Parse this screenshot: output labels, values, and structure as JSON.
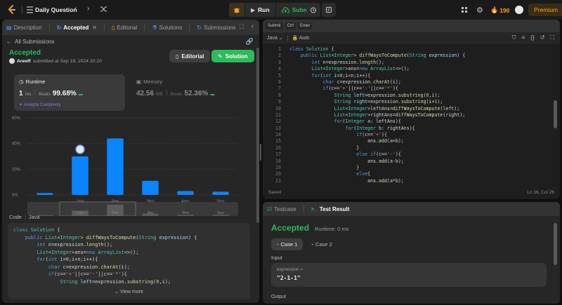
{
  "top": {
    "title": "Daily Question",
    "run_label": "Run",
    "submit_label": "Submit",
    "streak": "190",
    "premium_label": "Premium"
  },
  "left_tabs": [
    {
      "label": "Description"
    },
    {
      "label": "Accepted"
    },
    {
      "label": "Editorial"
    },
    {
      "label": "Solutions"
    },
    {
      "label": "Submissions"
    }
  ],
  "result": {
    "back_label": "All Submissions",
    "status": "Accepted",
    "user": "Areeff",
    "submitted_text": "submitted at Sep 19, 2024 20:20",
    "editorial_btn": "Editorial",
    "solution_btn": "Solution",
    "runtime_label": "Runtime",
    "runtime_value": "1",
    "runtime_unit": "ms",
    "beats_label": "Beats",
    "runtime_beats": "99.68%",
    "analyze_label": "Analyze Complexity",
    "memory_label": "Memory",
    "memory_value": "42.56",
    "memory_unit": "MB",
    "memory_beats": "52.36%"
  },
  "chart_data": {
    "type": "bar",
    "y_ticks": [
      "60%",
      "40%",
      "20%",
      "0%"
    ],
    "ylim": [
      0,
      60
    ],
    "categories": [
      "",
      "1ms",
      "2ms",
      "3ms",
      "4ms",
      "5ms"
    ],
    "values": [
      1.5,
      30,
      44,
      11,
      3,
      2.5
    ],
    "highlight_index": 1,
    "accent": "#0a84ff",
    "mini_values": [
      2,
      14,
      30,
      6,
      3,
      3
    ],
    "mini_labels": [
      "",
      "1ms",
      "2ms",
      "3ms",
      "4ms",
      "5ms"
    ]
  },
  "code_section": {
    "label": "Code",
    "lang": "Java",
    "view_more": "View more",
    "lines": [
      [
        [
          "kw",
          "class "
        ],
        [
          "ty",
          "Solution "
        ],
        [
          "pl",
          "{"
        ]
      ],
      [
        [
          "kw",
          "    public "
        ],
        [
          "ty",
          "List"
        ],
        [
          "pl",
          "<"
        ],
        [
          "ty",
          "Integer"
        ],
        [
          "pl",
          "> "
        ],
        [
          "fn",
          "diffWaysToCompute"
        ],
        [
          "pl",
          "("
        ],
        [
          "ty",
          "String "
        ],
        [
          "vr",
          "expression"
        ],
        [
          "pl",
          ") {"
        ]
      ],
      [
        [
          "kw",
          "        int "
        ],
        [
          "vr",
          "n"
        ],
        [
          "pl",
          "=expression."
        ],
        [
          "fn",
          "length"
        ],
        [
          "pl",
          "();"
        ]
      ],
      [
        [
          "ty",
          "        List"
        ],
        [
          "pl",
          "<"
        ],
        [
          "ty",
          "Integer"
        ],
        [
          "pl",
          ">ans="
        ],
        [
          "kw",
          "new "
        ],
        [
          "ty",
          "ArrayList"
        ],
        [
          "pl",
          "<>();"
        ]
      ],
      [
        [
          "kw",
          "        for"
        ],
        [
          "pl",
          "("
        ],
        [
          "kw",
          "int "
        ],
        [
          "vr",
          "i"
        ],
        [
          "pl",
          "="
        ],
        [
          "nm",
          "0"
        ],
        [
          "pl",
          ";i<n;i++){"
        ]
      ],
      [
        [
          "kw",
          "            char "
        ],
        [
          "vr",
          "c"
        ],
        [
          "pl",
          "=expression."
        ],
        [
          "fn",
          "charAt"
        ],
        [
          "pl",
          "(i);"
        ]
      ],
      [
        [
          "kw",
          "            if"
        ],
        [
          "pl",
          "(c=="
        ],
        [
          "st",
          "'+'"
        ],
        [
          "pl",
          "||c=="
        ],
        [
          "st",
          "'-'"
        ],
        [
          "pl",
          "||c=="
        ],
        [
          "st",
          "'*'"
        ],
        [
          "pl",
          "){"
        ]
      ],
      [
        [
          "ty",
          "                String "
        ],
        [
          "vr",
          "left"
        ],
        [
          "pl",
          "=expression."
        ],
        [
          "fn",
          "substring"
        ],
        [
          "pl",
          "("
        ],
        [
          "nm",
          "0"
        ],
        [
          "pl",
          ",i);"
        ]
      ]
    ]
  },
  "editor": {
    "submit_hint": "Submit",
    "key1": "Ctrl",
    "key2": "Enter",
    "lang": "Java",
    "mode": "Auto",
    "saved": "Saved",
    "cursor": "Ln 16, Col 26",
    "lines": [
      [
        [
          "kw",
          "class "
        ],
        [
          "ty",
          "Solution "
        ],
        [
          "pl",
          "{"
        ]
      ],
      [
        [
          "kw",
          "    public "
        ],
        [
          "ty",
          "List"
        ],
        [
          "pl",
          "<"
        ],
        [
          "ty",
          "Integer"
        ],
        [
          "pl",
          "> "
        ],
        [
          "fn",
          "diffWaysToCompute"
        ],
        [
          "pl",
          "("
        ],
        [
          "ty",
          "String "
        ],
        [
          "vr",
          "expression"
        ],
        [
          "pl",
          ") {"
        ]
      ],
      [
        [
          "kw",
          "        int "
        ],
        [
          "vr",
          "n"
        ],
        [
          "pl",
          "=expression."
        ],
        [
          "fn",
          "length"
        ],
        [
          "pl",
          "();"
        ]
      ],
      [
        [
          "ty",
          "        List"
        ],
        [
          "pl",
          "<"
        ],
        [
          "ty",
          "Integer"
        ],
        [
          "pl",
          ">ans="
        ],
        [
          "kw",
          "new "
        ],
        [
          "ty",
          "ArrayList"
        ],
        [
          "pl",
          "<>();"
        ]
      ],
      [
        [
          "kw",
          "        for"
        ],
        [
          "pl",
          "("
        ],
        [
          "kw",
          "int "
        ],
        [
          "vr",
          "i"
        ],
        [
          "pl",
          "="
        ],
        [
          "nm",
          "0"
        ],
        [
          "pl",
          ";i<n;i++){"
        ]
      ],
      [
        [
          "kw",
          "            char "
        ],
        [
          "vr",
          "c"
        ],
        [
          "pl",
          "=expression."
        ],
        [
          "fn",
          "charAt"
        ],
        [
          "pl",
          "(i);"
        ]
      ],
      [
        [
          "kw",
          "            if"
        ],
        [
          "pl",
          "(c=="
        ],
        [
          "st",
          "'+'"
        ],
        [
          "pl",
          "||c=="
        ],
        [
          "st",
          "'-'"
        ],
        [
          "pl",
          "||c=="
        ],
        [
          "st",
          "'*'"
        ],
        [
          "pl",
          "){"
        ]
      ],
      [
        [
          "ty",
          "                String "
        ],
        [
          "vr",
          "left"
        ],
        [
          "pl",
          "=expression."
        ],
        [
          "fn",
          "substring"
        ],
        [
          "pl",
          "("
        ],
        [
          "nm",
          "0"
        ],
        [
          "pl",
          ",i);"
        ]
      ],
      [
        [
          "ty",
          "                String "
        ],
        [
          "vr",
          "right"
        ],
        [
          "pl",
          "=expression."
        ],
        [
          "fn",
          "substring"
        ],
        [
          "pl",
          "(i+"
        ],
        [
          "nm",
          "1"
        ],
        [
          "pl",
          ");"
        ]
      ],
      [
        [
          "ty",
          "                List"
        ],
        [
          "pl",
          "<"
        ],
        [
          "ty",
          "Integer"
        ],
        [
          "pl",
          ">leftAns="
        ],
        [
          "fn",
          "diffWaysToCompute"
        ],
        [
          "pl",
          "(left);"
        ]
      ],
      [
        [
          "ty",
          "                List"
        ],
        [
          "pl",
          "<"
        ],
        [
          "ty",
          "Integer"
        ],
        [
          "pl",
          ">rightAns="
        ],
        [
          "fn",
          "diffWaysToCompute"
        ],
        [
          "pl",
          "(right);"
        ]
      ],
      [
        [
          "kw",
          "                for"
        ],
        [
          "pl",
          "("
        ],
        [
          "ty",
          "Integer "
        ],
        [
          "vr",
          "a"
        ],
        [
          "pl",
          ": leftAns){"
        ]
      ],
      [
        [
          "kw",
          "                    for"
        ],
        [
          "pl",
          "("
        ],
        [
          "ty",
          "Integer "
        ],
        [
          "vr",
          "b"
        ],
        [
          "pl",
          ": rightAns){"
        ]
      ],
      [
        [
          "kw",
          "                        if"
        ],
        [
          "pl",
          "(c=="
        ],
        [
          "st",
          "'+'"
        ],
        [
          "pl",
          "){"
        ]
      ],
      [
        [
          "pl",
          "                            ans."
        ],
        [
          "fn",
          "add"
        ],
        [
          "pl",
          "(a+b);"
        ]
      ],
      [
        [
          "pl",
          "                        }"
        ]
      ],
      [
        [
          "kw",
          "                        else if"
        ],
        [
          "pl",
          "(c=="
        ],
        [
          "st",
          "'-'"
        ],
        [
          "pl",
          "){"
        ]
      ],
      [
        [
          "pl",
          "                            ans."
        ],
        [
          "fn",
          "add"
        ],
        [
          "pl",
          "(a-b);"
        ]
      ],
      [
        [
          "pl",
          "                        }"
        ]
      ],
      [
        [
          "kw",
          "                        else"
        ],
        [
          "pl",
          "{"
        ]
      ],
      [
        [
          "pl",
          "                            ans."
        ],
        [
          "fn",
          "add"
        ],
        [
          "pl",
          "(a*b);"
        ]
      ]
    ]
  },
  "console": {
    "tab_testcase": "Testcase",
    "tab_result": "Test Result",
    "status": "Accepted",
    "runtime": "Runtime: 0 ms",
    "case1": "Case 1",
    "case2": "Case 2",
    "input_label": "Input",
    "var_label": "expression =",
    "var_value": "\"2-1-1\"",
    "output_label": "Output"
  }
}
